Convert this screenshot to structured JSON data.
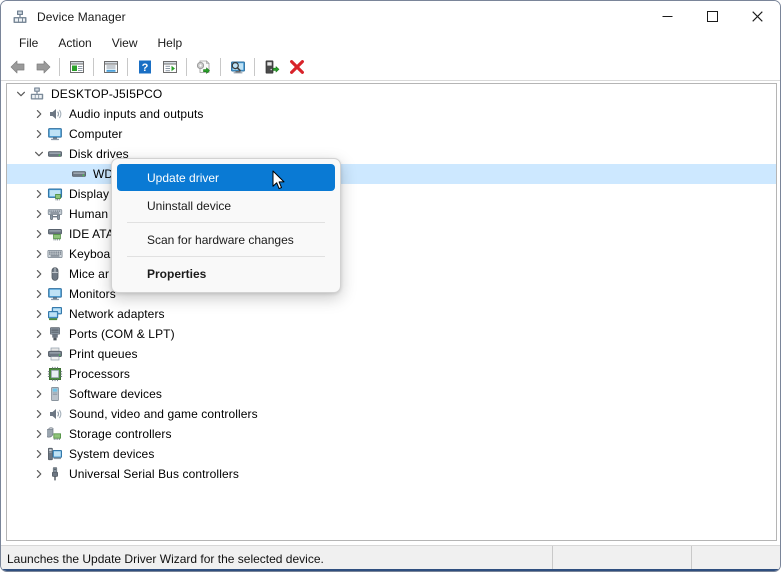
{
  "window": {
    "title": "Device Manager",
    "title_icon": "device-manager-icon",
    "minimize_label": "–",
    "maximize_label": "□",
    "close_label": "✕"
  },
  "menubar": {
    "items": [
      {
        "label": "File"
      },
      {
        "label": "Action"
      },
      {
        "label": "View"
      },
      {
        "label": "Help"
      }
    ]
  },
  "toolbar": {
    "buttons": [
      {
        "name": "back-arrow-icon",
        "tooltip": "Back"
      },
      {
        "name": "forward-arrow-icon",
        "tooltip": "Forward"
      },
      {
        "name": "show-hide-console-tree-icon",
        "tooltip": "Show/Hide console tree"
      },
      {
        "name": "properties-icon",
        "tooltip": "Properties"
      },
      {
        "name": "help-icon",
        "tooltip": "Help"
      },
      {
        "name": "view-icon",
        "tooltip": "View"
      },
      {
        "name": "update-driver-icon",
        "tooltip": "Update driver"
      },
      {
        "name": "scan-for-hardware-changes-icon",
        "tooltip": "Scan for hardware changes"
      },
      {
        "name": "enable-device-icon",
        "tooltip": "Enable device"
      },
      {
        "name": "uninstall-device-icon",
        "tooltip": "Uninstall device"
      }
    ]
  },
  "tree": {
    "root": {
      "label": "DESKTOP-J5I5PCO",
      "icon": "computer-node-icon",
      "expanded": true
    },
    "items": [
      {
        "label": "Audio inputs and outputs",
        "icon": "speaker-icon",
        "expanded": false,
        "level": 1
      },
      {
        "label": "Computer",
        "icon": "monitor-icon",
        "expanded": false,
        "level": 1
      },
      {
        "label": "Disk drives",
        "icon": "disk-drive-icon",
        "expanded": true,
        "level": 1
      },
      {
        "label": "WD",
        "icon": "disk-drive-icon",
        "expanded": null,
        "level": 2,
        "selected": true
      },
      {
        "label": "Display",
        "icon": "display-adapter-icon",
        "expanded": false,
        "level": 1
      },
      {
        "label": "Human",
        "icon": "hid-icon",
        "expanded": false,
        "level": 1
      },
      {
        "label": "IDE ATA",
        "icon": "ide-controller-icon",
        "expanded": false,
        "level": 1
      },
      {
        "label": "Keyboa",
        "icon": "keyboard-icon",
        "expanded": false,
        "level": 1
      },
      {
        "label": "Mice ar",
        "icon": "mouse-icon",
        "expanded": false,
        "level": 1
      },
      {
        "label": "Monitors",
        "icon": "monitor-icon",
        "expanded": false,
        "level": 1
      },
      {
        "label": "Network adapters",
        "icon": "network-adapter-icon",
        "expanded": false,
        "level": 1
      },
      {
        "label": "Ports (COM & LPT)",
        "icon": "port-icon",
        "expanded": false,
        "level": 1
      },
      {
        "label": "Print queues",
        "icon": "printer-icon",
        "expanded": false,
        "level": 1
      },
      {
        "label": "Processors",
        "icon": "processor-icon",
        "expanded": false,
        "level": 1
      },
      {
        "label": "Software devices",
        "icon": "software-device-icon",
        "expanded": false,
        "level": 1
      },
      {
        "label": "Sound, video and game controllers",
        "icon": "speaker-icon",
        "expanded": false,
        "level": 1
      },
      {
        "label": "Storage controllers",
        "icon": "storage-controller-icon",
        "expanded": false,
        "level": 1
      },
      {
        "label": "System devices",
        "icon": "system-device-icon",
        "expanded": false,
        "level": 1
      },
      {
        "label": "Universal Serial Bus controllers",
        "icon": "usb-icon",
        "expanded": false,
        "level": 1
      }
    ]
  },
  "context_menu": {
    "items": [
      {
        "label": "Update driver",
        "highlighted": true,
        "bold": false
      },
      {
        "label": "Uninstall device",
        "highlighted": false,
        "bold": false
      },
      {
        "separator_after": true
      },
      {
        "label": "Scan for hardware changes",
        "highlighted": false,
        "bold": false
      },
      {
        "separator_after": true
      },
      {
        "label": "Properties",
        "highlighted": false,
        "bold": true
      }
    ]
  },
  "statusbar": {
    "message": "Launches the Update Driver Wizard for the selected device."
  },
  "colors": {
    "menu_highlight": "#0a7ad4",
    "tree_selection": "#cde8ff",
    "window_border": "#7a8599",
    "statusbar_bg": "#f0f0f0",
    "toolbar_red": "#d8232a",
    "toolbar_green": "#2aa02a",
    "toolbar_blue": "#1a6fc4"
  }
}
